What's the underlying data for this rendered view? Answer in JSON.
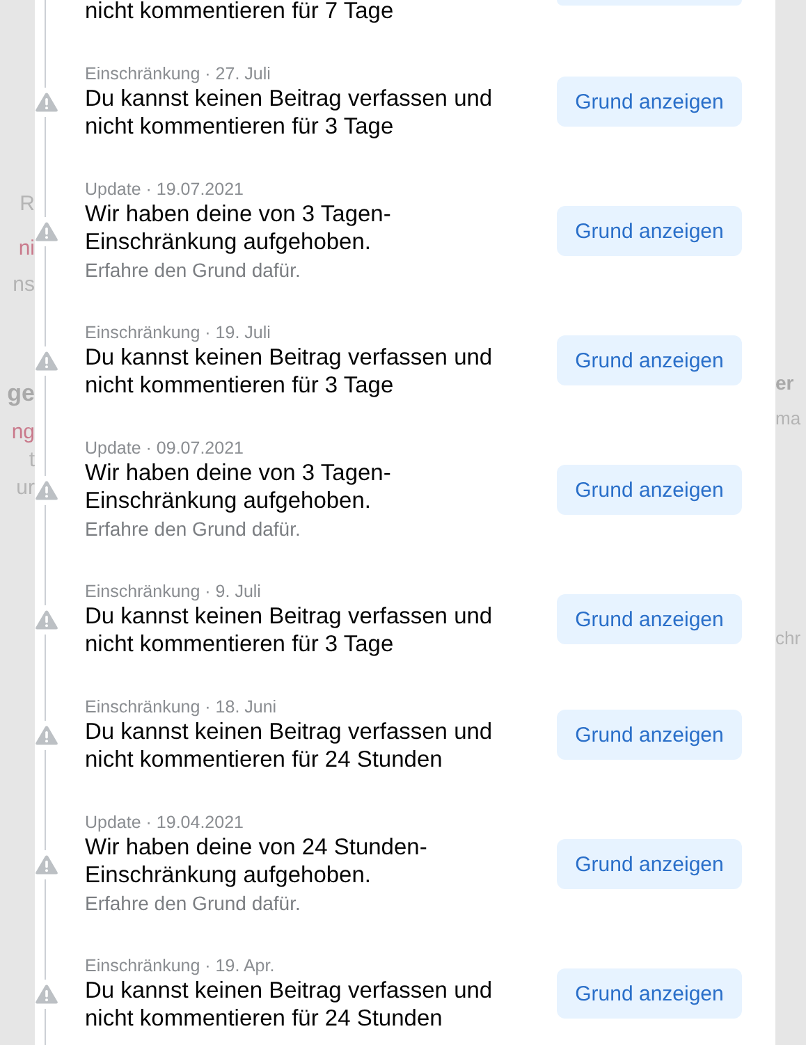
{
  "background": {
    "left_fragments": [
      {
        "text": "R",
        "kind": "plain"
      },
      {
        "text": "ni",
        "kind": "accent"
      },
      {
        "text": "ns",
        "kind": "plain"
      },
      {
        "text": "ge",
        "kind": "heading"
      },
      {
        "text": "ng",
        "kind": "accent"
      },
      {
        "text": "t",
        "kind": "plain"
      },
      {
        "text": "ur",
        "kind": "plain"
      }
    ],
    "right_fragments": [
      {
        "text": "er",
        "kind": "heading"
      },
      {
        "text": "ma",
        "kind": "plain"
      },
      {
        "text": "chr",
        "kind": "plain"
      }
    ]
  },
  "entries": [
    {
      "kind": "partial",
      "title": "nicht kommentieren für 7 Tage"
    },
    {
      "kind": "restriction",
      "meta": "Einschränkung · 27. Juli",
      "title": "Du kannst keinen Beitrag verfassen und nicht kommentieren für 3 Tage",
      "button": "Grund anzeigen"
    },
    {
      "kind": "update",
      "meta": "Update · 19.07.2021",
      "title": "Wir haben deine von 3 Tagen-Einschränkung aufgehoben.",
      "note": "Erfahre den Grund dafür.",
      "button": "Grund anzeigen"
    },
    {
      "kind": "restriction",
      "meta": "Einschränkung · 19. Juli",
      "title": "Du kannst keinen Beitrag verfassen und nicht kommentieren für 3 Tage",
      "button": "Grund anzeigen"
    },
    {
      "kind": "update",
      "meta": "Update · 09.07.2021",
      "title": "Wir haben deine von 3 Tagen-Einschränkung aufgehoben.",
      "note": "Erfahre den Grund dafür.",
      "button": "Grund anzeigen"
    },
    {
      "kind": "restriction",
      "meta": "Einschränkung · 9. Juli",
      "title": "Du kannst keinen Beitrag verfassen und nicht kommentieren für 3 Tage",
      "button": "Grund anzeigen"
    },
    {
      "kind": "restriction",
      "meta": "Einschränkung · 18. Juni",
      "title": "Du kannst keinen Beitrag verfassen und nicht kommentieren für 24 Stunden",
      "button": "Grund anzeigen"
    },
    {
      "kind": "update",
      "meta": "Update · 19.04.2021",
      "title": "Wir haben deine von 24 Stunden-Einschränkung aufgehoben.",
      "note": "Erfahre den Grund dafür.",
      "button": "Grund anzeigen"
    },
    {
      "kind": "restriction",
      "meta": "Einschränkung · 19. Apr.",
      "title": "Du kannst keinen Beitrag verfassen und nicht kommentieren für 24 Stunden",
      "button": "Grund anzeigen"
    }
  ]
}
